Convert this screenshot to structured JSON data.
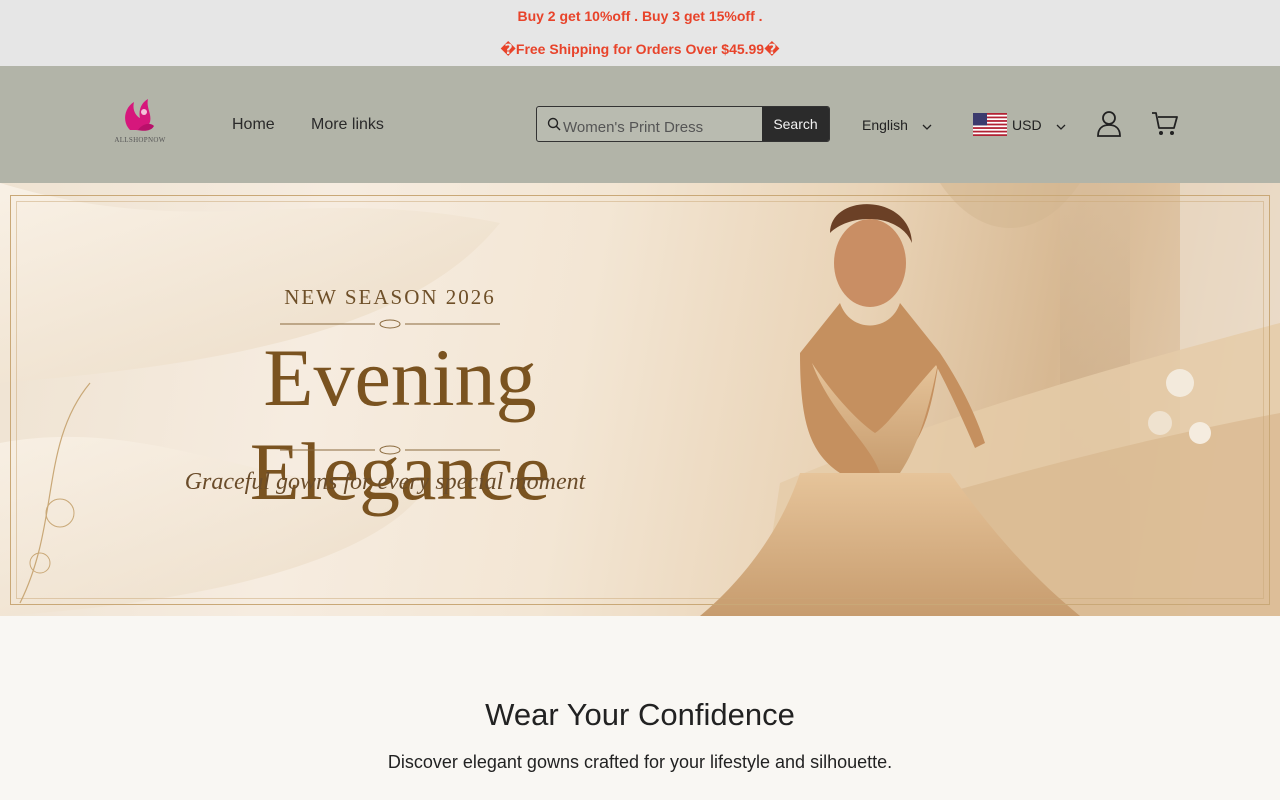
{
  "announcement": {
    "line1": "Buy 2 get 10%off . Buy 3 get 15%off .",
    "line2": "�Free Shipping for Orders Over $45.99�"
  },
  "header": {
    "logo_text": "ALLSHOPNOW",
    "nav": [
      "Home",
      "More links"
    ],
    "search": {
      "placeholder": "Women's Print Dress",
      "button": "Search"
    },
    "language": "English",
    "currency": "USD"
  },
  "hero": {
    "kicker": "NEW SEASON 2026",
    "title": "Evening Elegance",
    "subtitle": "Graceful gowns for every special moment"
  },
  "section": {
    "heading": "Wear Your Confidence",
    "text": "Discover elegant gowns crafted for your lifestyle and silhouette."
  },
  "colors": {
    "announcement_text": "#e8432a",
    "header_bg": "#b2b4a8",
    "logo_pink": "#d6177c"
  }
}
